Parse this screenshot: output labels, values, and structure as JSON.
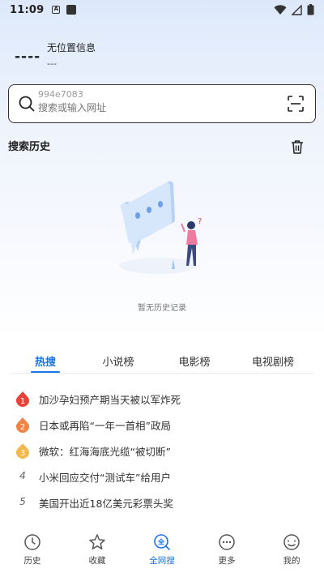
{
  "status_bar": {
    "time": "11:09",
    "notif_letter": "A"
  },
  "weather": {
    "placeholder": "----",
    "location": "无位置信息",
    "sub": "---"
  },
  "search": {
    "hint": "994e7083",
    "placeholder": "搜索或输入网址"
  },
  "history": {
    "title": "搜索历史",
    "empty_text": "暂无历史记录"
  },
  "tabs": [
    {
      "label": "热搜",
      "active": true
    },
    {
      "label": "小说榜",
      "active": false
    },
    {
      "label": "电影榜",
      "active": false
    },
    {
      "label": "电视剧榜",
      "active": false
    }
  ],
  "hot_list": [
    {
      "rank": "1",
      "text": "加沙孕妇预产期当天被以军炸死",
      "badge_color": "#e8423a"
    },
    {
      "rank": "2",
      "text": "日本或再陷“一年一首相”政局",
      "badge_color": "#f08447"
    },
    {
      "rank": "3",
      "text": "微软：红海海底光缆“被切断”",
      "badge_color": "#f3b84e"
    },
    {
      "rank": "4",
      "text": "小米回应交付“测试车”给用户"
    },
    {
      "rank": "5",
      "text": "美国开出近18亿美元彩票头奖"
    }
  ],
  "bottom_nav": [
    {
      "label": "历史",
      "icon": "clock-icon",
      "active": false
    },
    {
      "label": "收藏",
      "icon": "star-icon",
      "active": false
    },
    {
      "label": "全网搜",
      "icon": "global-search-icon",
      "active": true
    },
    {
      "label": "更多",
      "icon": "more-icon",
      "active": false
    },
    {
      "label": "我的",
      "icon": "profile-icon",
      "active": false
    }
  ],
  "colors": {
    "accent": "#1a73e8",
    "text": "#333333"
  }
}
